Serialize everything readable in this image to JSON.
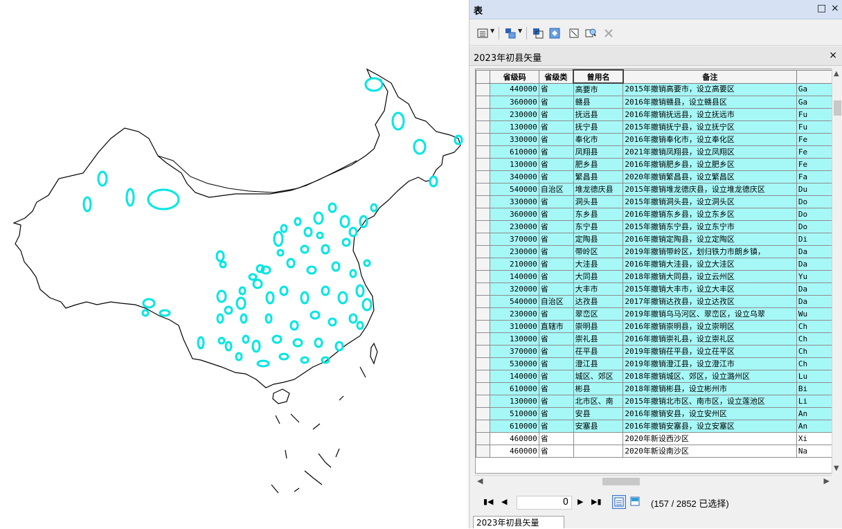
{
  "window": {
    "title": "表",
    "restore_glyph": "□",
    "close_glyph": "×"
  },
  "toolbar": {
    "buttons": [
      "table-options-icon",
      "related-tables-icon",
      "select-by-attributes-icon",
      "switch-selection-icon",
      "clear-selection-icon",
      "zoom-to-selected-icon",
      "delete-selected-icon"
    ]
  },
  "tab": {
    "name": "2023年初县矢量",
    "close_glyph": "×"
  },
  "table": {
    "columns": [
      "",
      "省级码",
      "省级类",
      "曾用名",
      "备注",
      ""
    ],
    "rows": [
      {
        "code": "440000",
        "type": "省",
        "name": "高要市",
        "note": "2015年撤销高要市，设立高要区",
        "extra": "Ga",
        "selected": true
      },
      {
        "code": "360000",
        "type": "省",
        "name": "赣县",
        "note": "2016年撤销赣县，设立赣县区",
        "extra": "Ga",
        "selected": true
      },
      {
        "code": "230000",
        "type": "省",
        "name": "抚远县",
        "note": "2016年撤销抚远县，设立抚远市",
        "extra": "Fu",
        "selected": true
      },
      {
        "code": "130000",
        "type": "省",
        "name": "抚宁县",
        "note": "2015年撤销抚宁县，设立抚宁区",
        "extra": "Fu",
        "selected": true
      },
      {
        "code": "330000",
        "type": "省",
        "name": "奉化市",
        "note": "2016年撤销奉化市，设立奉化区",
        "extra": "Fe",
        "selected": true
      },
      {
        "code": "610000",
        "type": "省",
        "name": "凤翔县",
        "note": "2021年撤销凤翔县，设立凤翔区",
        "extra": "Fe",
        "selected": true
      },
      {
        "code": "130000",
        "type": "省",
        "name": "肥乡县",
        "note": "2016年撤销肥乡县，设立肥乡区",
        "extra": "Fe",
        "selected": true
      },
      {
        "code": "340000",
        "type": "省",
        "name": "繁昌县",
        "note": "2020年撤销繁昌县，设立繁昌区",
        "extra": "Fa",
        "selected": true
      },
      {
        "code": "540000",
        "type": "自治区",
        "name": "堆龙德庆县",
        "note": "2015年撤销堆龙德庆县，设立堆龙德庆区",
        "extra": "Du",
        "selected": true
      },
      {
        "code": "330000",
        "type": "省",
        "name": "洞头县",
        "note": "2015年撤销洞头县，设立洞头区",
        "extra": "Do",
        "selected": true
      },
      {
        "code": "360000",
        "type": "省",
        "name": "东乡县",
        "note": "2016年撤销东乡县，设立东乡区",
        "extra": "Do",
        "selected": true
      },
      {
        "code": "230000",
        "type": "省",
        "name": "东宁县",
        "note": "2015年撤销东宁县，设立东宁市",
        "extra": "Do",
        "selected": true
      },
      {
        "code": "370000",
        "type": "省",
        "name": "定陶县",
        "note": "2016年撤销定陶县，设立定陶区",
        "extra": "Di",
        "selected": true
      },
      {
        "code": "230000",
        "type": "省",
        "name": "带岭区",
        "note": "2019年撤销带岭区，划归铁力市朗乡镇，",
        "extra": "Da",
        "selected": true
      },
      {
        "code": "210000",
        "type": "省",
        "name": "大洼县",
        "note": "2016年撤销大洼县，设立大洼区",
        "extra": "Da",
        "selected": true
      },
      {
        "code": "140000",
        "type": "省",
        "name": "大同县",
        "note": "2018年撤销大同县，设立云州区",
        "extra": "Yu",
        "selected": true
      },
      {
        "code": "320000",
        "type": "省",
        "name": "大丰市",
        "note": "2015年撤销大丰市，设立大丰区",
        "extra": "Da",
        "selected": true
      },
      {
        "code": "540000",
        "type": "自治区",
        "name": "达孜县",
        "note": "2017年撤销达孜县，设立达孜区",
        "extra": "Da",
        "selected": true
      },
      {
        "code": "230000",
        "type": "省",
        "name": "翠峦区",
        "note": "2019年撤销乌马河区、翠峦区，设立乌翠",
        "extra": "Wu",
        "selected": true
      },
      {
        "code": "310000",
        "type": "直辖市",
        "name": "崇明县",
        "note": "2016年撤销崇明县，设立崇明区",
        "extra": "Ch",
        "selected": true
      },
      {
        "code": "130000",
        "type": "省",
        "name": "崇礼县",
        "note": "2016年撤销崇礼县，设立崇礼区",
        "extra": "Ch",
        "selected": true
      },
      {
        "code": "370000",
        "type": "省",
        "name": "茌平县",
        "note": "2019年撤销茌平县，设立茌平区",
        "extra": "Ch",
        "selected": true
      },
      {
        "code": "530000",
        "type": "省",
        "name": "澄江县",
        "note": "2019年撤销澄江县，设立澄江市",
        "extra": "Ch",
        "selected": true
      },
      {
        "code": "140000",
        "type": "省",
        "name": "城区、郊区",
        "note": "2018年撤销城区、郊区，设立潞州区",
        "extra": "Lu",
        "selected": true
      },
      {
        "code": "610000",
        "type": "省",
        "name": "彬县",
        "note": "2018年撤销彬县，设立彬州市",
        "extra": "Bi",
        "selected": true
      },
      {
        "code": "130000",
        "type": "省",
        "name": "北市区、南",
        "note": "2015年撤销北市区、南市区，设立莲池区",
        "extra": "Li",
        "selected": true
      },
      {
        "code": "510000",
        "type": "省",
        "name": "安县",
        "note": "2016年撤销安县，设立安州区",
        "extra": "An",
        "selected": true
      },
      {
        "code": "610000",
        "type": "省",
        "name": "安塞县",
        "note": "2016年撤销安塞县，设立安塞区",
        "extra": "An",
        "selected": true
      },
      {
        "code": "460000",
        "type": "省",
        "name": "",
        "note": "2020年新设西沙区",
        "extra": "Xi",
        "selected": false
      },
      {
        "code": "460000",
        "type": "省",
        "name": "",
        "note": "2020年新设南沙区",
        "extra": "Na",
        "selected": false
      }
    ]
  },
  "navigation": {
    "current_record": "0",
    "status": "(157 / 2852 已选择)"
  },
  "bottom_tab": {
    "name": "2023年初县矢量"
  },
  "colors": {
    "selected_fill": "#a6f8f7",
    "highlight_outline": "#00e5e5",
    "boundary": "#000000"
  }
}
